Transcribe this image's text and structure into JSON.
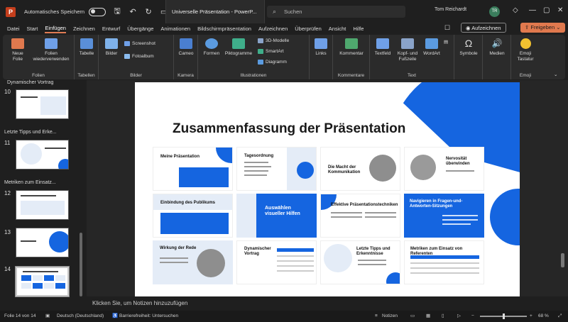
{
  "titlebar": {
    "autosave_label": "Automatisches Speichern",
    "doc_title": "Universelle Präsentation - PowerP...",
    "search_placeholder": "Suchen",
    "user_name": "Tom Reichardt",
    "user_initials": "TR"
  },
  "ribbon_tabs": [
    "Datei",
    "Start",
    "Einfügen",
    "Zeichnen",
    "Entwurf",
    "Übergänge",
    "Animationen",
    "Bildschirmpräsentation",
    "Aufzeichnen",
    "Überprüfen",
    "Ansicht",
    "Hilfe"
  ],
  "actions": {
    "record": "Aufzeichnen",
    "share": "Freigeben"
  },
  "ribbon": {
    "new_slide": "Neue Folie",
    "reuse_slides": "Folien wiederverwenden",
    "group_slides": "Folien",
    "table": "Tabelle",
    "group_tables": "Tabellen",
    "pictures": "Bilder",
    "screenshot": "Screenshot",
    "photo_album": "Fotoalbum",
    "group_images": "Bilder",
    "cameo": "Cameo",
    "group_camera": "Kamera",
    "shapes": "Formen",
    "icons": "Piktogramme",
    "models3d": "3D-Modelle",
    "smartart": "SmartArt",
    "chart": "Diagramm",
    "group_illustrations": "Illustrationen",
    "links": "Links",
    "comment": "Kommentar",
    "group_comments": "Kommentare",
    "textbox": "Textfeld",
    "header_footer": "Kopf- und Fußzeile",
    "wordart": "WordArt",
    "group_text": "Text",
    "symbols": "Symbole",
    "media": "Medien",
    "emoji": "Emoji Tastatur",
    "group_emoji": "Emoji"
  },
  "thumbnails": {
    "sections": [
      "Dynamischer Vortrag",
      "Letzte Tipps und Erke...",
      "Metriken zum Einsatz..."
    ],
    "numbers": [
      "10",
      "11",
      "12",
      "13",
      "14"
    ]
  },
  "slide": {
    "title": "Zusammenfassung der Präsentation",
    "cards": [
      "Meine Präsentation",
      "Tagesordnung",
      "Die Macht der Kommunikation",
      "Nervosität überwinden",
      "Einbindung des Publikums",
      "Auswählen visueller Hilfen",
      "Effektive Präsentationstechniken",
      "Navigieren in Fragen-und-Antworten-Sitzungen",
      "Wirkung der Rede",
      "Dynamischer Vortrag",
      "Letzte Tipps und Erkenntnisse",
      "Metriken zum Einsatz von Referenten"
    ]
  },
  "notes_placeholder": "Klicken Sie, um Notizen hinzuzufügen",
  "status": {
    "slide_of": "Folie 14 von 14",
    "language": "Deutsch (Deutschland)",
    "accessibility": "Barrierefreiheit: Untersuchen",
    "notes": "Notizen",
    "zoom": "68 %"
  },
  "colors": {
    "accent": "#1565e0",
    "brand": "#c43e1c",
    "share": "#e0794e",
    "tab_underline": "#e07b53"
  }
}
